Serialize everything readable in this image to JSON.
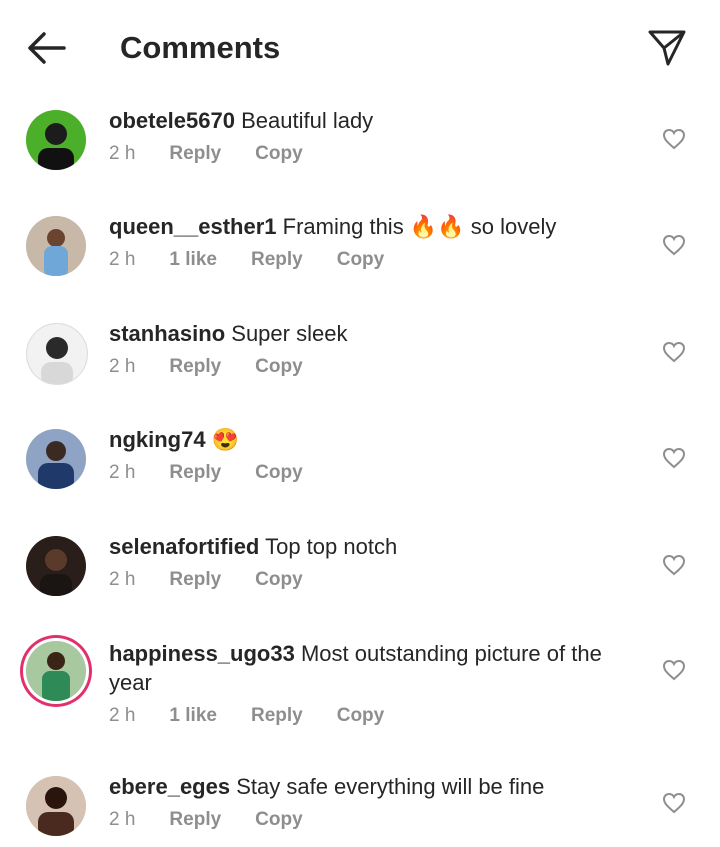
{
  "header": {
    "title": "Comments",
    "back_icon": "arrow-left-icon",
    "send_icon": "paper-plane-icon"
  },
  "comments": [
    {
      "user": "obetele5670",
      "text": "Beautiful lady",
      "emoji": "",
      "time": "2 h",
      "likes": "",
      "reply": "Reply",
      "copy": "Copy",
      "avatar_color": "#2e7d1f"
    },
    {
      "user": "queen__esther1",
      "text": "Framing this",
      "emoji": "🔥🔥",
      "text2": "so lovely",
      "time": "2 h",
      "likes": "1 like",
      "reply": "Reply",
      "copy": "Copy",
      "avatar_color": "#6ea7d8"
    },
    {
      "user": "stanhasino",
      "text": "Super sleek",
      "emoji": "",
      "time": "2 h",
      "likes": "",
      "reply": "Reply",
      "copy": "Copy",
      "avatar_color": "#e8e8e8"
    },
    {
      "user": "ngking74",
      "text": "",
      "emoji": "😍",
      "time": "2 h",
      "likes": "",
      "reply": "Reply",
      "copy": "Copy",
      "avatar_color": "#2b3a55"
    },
    {
      "user": "selenafortified",
      "text": "Top top notch",
      "emoji": "",
      "time": "2 h",
      "likes": "",
      "reply": "Reply",
      "copy": "Copy",
      "avatar_color": "#3a2a22"
    },
    {
      "user": "happiness_ugo33",
      "text": "Most outstanding picture of the year",
      "emoji": "",
      "time": "2 h",
      "likes": "1 like",
      "reply": "Reply",
      "copy": "Copy",
      "avatar_color": "#5a8a5a"
    },
    {
      "user": "ebere_eges",
      "text": "Stay safe everything will be fine",
      "emoji": "",
      "time": "2 h",
      "likes": "",
      "reply": "Reply",
      "copy": "Copy",
      "avatar_color": "#4a2a1e"
    }
  ],
  "colors": {
    "accent_story_ring": "#e1306c",
    "meta_text": "#8e8e8e",
    "text": "#262626"
  }
}
